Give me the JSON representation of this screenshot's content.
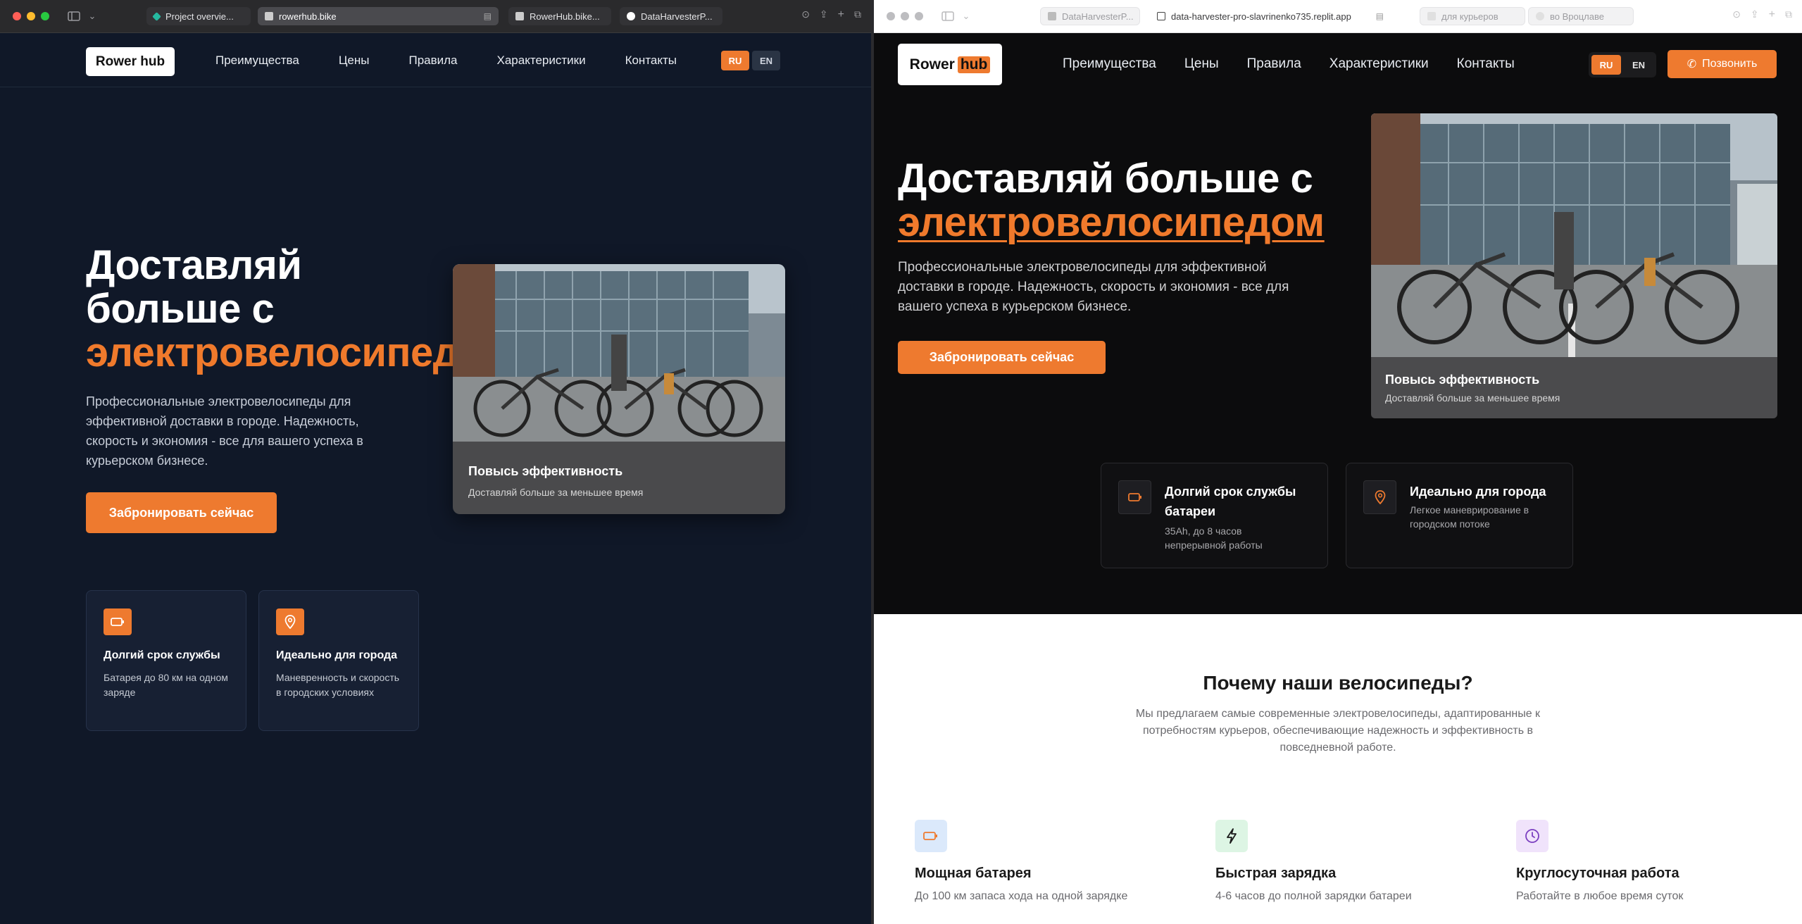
{
  "left_window": {
    "tabs": [
      {
        "label": "Project overvie...",
        "favicon_color": "#25b9a0"
      },
      {
        "label": "rowerhub.bike",
        "favicon_color": "#cccccc",
        "active": true
      },
      {
        "label": "RowerHub.bike...",
        "favicon_color": "#cccccc"
      },
      {
        "label": "DataHarvesterP...",
        "favicon_color": "#ffffff"
      }
    ],
    "header": {
      "logo": "Rower hub",
      "nav": [
        "Преимущества",
        "Цены",
        "Правила",
        "Характеристики",
        "Контакты"
      ],
      "lang": [
        "RU",
        "EN"
      ]
    },
    "hero": {
      "title_line1": "Доставляй",
      "title_line2": "больше с",
      "title_accent": "электровелосипед",
      "description": "Профессиональные электровелосипеды для эффективной доставки в городе. Надежность, скорость и экономия - все для вашего успеха в курьерском бизнесе.",
      "cta": "Забронировать сейчас"
    },
    "photo_card": {
      "title": "Повысь эффективность",
      "subtitle": "Доставляй больше за меньшее время"
    },
    "features": [
      {
        "icon": "battery-icon",
        "title": "Долгий срок службы",
        "text": "Батарея до 80 км на одном заряде"
      },
      {
        "icon": "map-pin-icon",
        "title": "Идеально для города",
        "text": "Маневренность и скорость в городских условиях"
      }
    ]
  },
  "right_window": {
    "tabs": [
      {
        "label": "DataHarvesterP...",
        "favicon_color": "#bbbbbb"
      },
      {
        "label": "data-harvester-pro-slavrinenko735.replit.app",
        "favicon_color": "#444444",
        "active": true
      },
      {
        "label": "для курьеров",
        "favicon_color": "#cccccc"
      },
      {
        "label": "во Вроцлаве",
        "favicon_color": "#cccccc"
      }
    ],
    "header": {
      "logo_part1": "Rower",
      "logo_part2": "hub",
      "nav": [
        "Преимущества",
        "Цены",
        "Правила",
        "Характеристики",
        "Контакты"
      ],
      "lang": [
        "RU",
        "EN"
      ],
      "call_button": "Позвонить"
    },
    "hero": {
      "title_line1": "Доставляй больше с",
      "title_accent": "электровелосипедом",
      "description": "Профессиональные электровелосипеды для эффективной доставки в городе. Надежность, скорость и экономия - все для вашего успеха в курьерском бизнесе.",
      "cta": "Забронировать сейчас"
    },
    "photo_card": {
      "title": "Повысь эффективность",
      "subtitle": "Доставляй больше за меньшее время"
    },
    "features": [
      {
        "icon": "battery-icon",
        "title_line1": "Долгий срок службы",
        "title_line2": "батареи",
        "text_line1": "35Ah, до 8 часов",
        "text_line2": "непрерывной работы"
      },
      {
        "icon": "map-pin-icon",
        "title_line1": "Идеально для города",
        "text_line1": "Легкое маневрирование в",
        "text_line2": "городском потоке"
      }
    ],
    "why": {
      "title": "Почему наши велосипеды?",
      "description": "Мы предлагаем самые современные электровелосипеды, адаптированные к потребностям курьеров, обеспечивающие надежность и эффективность в повседневной работе.",
      "benefits": [
        {
          "icon": "battery-icon",
          "title": "Мощная батарея",
          "text": "До 100 км запаса хода на одной зарядке"
        },
        {
          "icon": "lightning-icon",
          "title": "Быстрая зарядка",
          "text": "4-6 часов до полной зарядки батареи"
        },
        {
          "icon": "clock-icon",
          "title": "Круглосуточная работа",
          "text": "Работайте в любое время суток"
        }
      ]
    }
  },
  "colors": {
    "accent": "#ee7a2f",
    "left_bg": "#101828",
    "right_bg": "#0c0c0d",
    "card_caption_bg": "#4a4a4c"
  }
}
